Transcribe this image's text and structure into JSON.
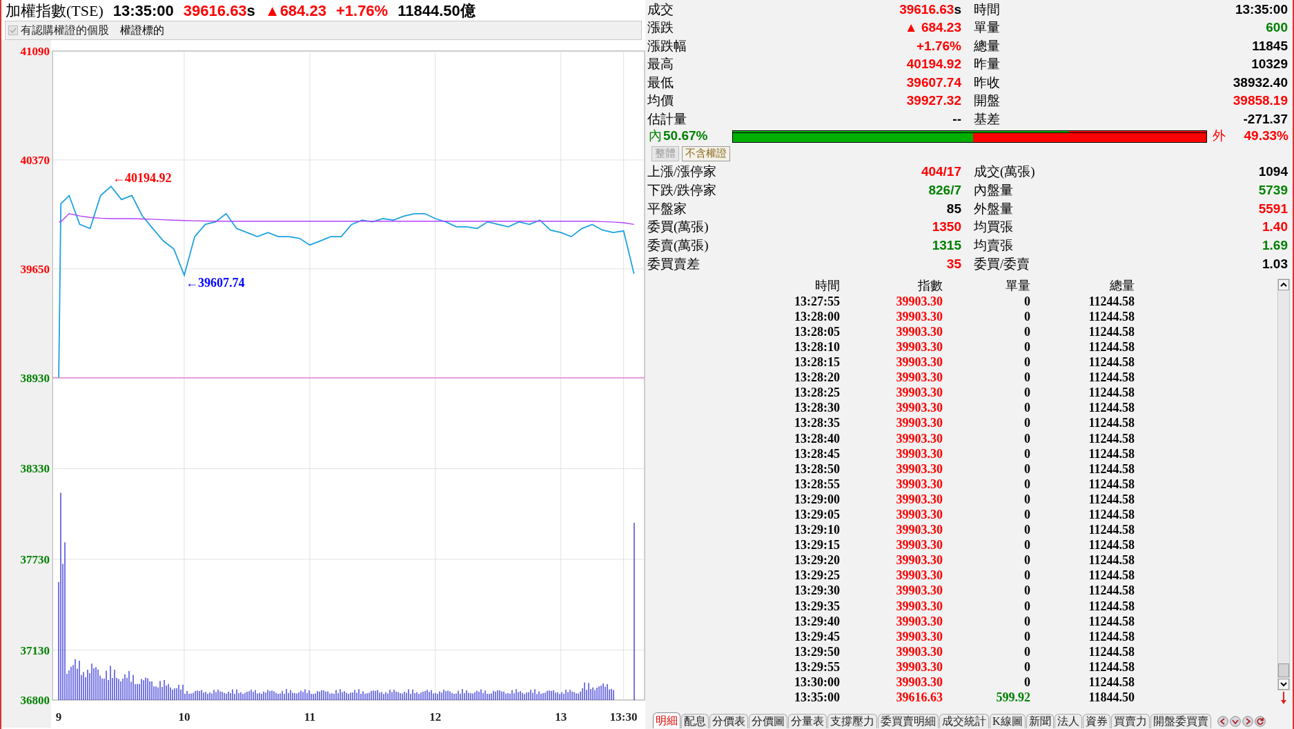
{
  "header": {
    "items": [
      {
        "kind": "name",
        "text": "加權指數(TSE)",
        "color": "#000000"
      },
      {
        "kind": "value",
        "text": "13:35:00",
        "color": "#000000"
      },
      {
        "kind": "value",
        "text": "39616.63",
        "suffix": "s",
        "color": "#ff0000"
      },
      {
        "kind": "value",
        "text": "▲684.23",
        "color": "#ff0000"
      },
      {
        "kind": "value",
        "text": "+1.76%",
        "color": "#ff0000"
      },
      {
        "kind": "value",
        "text": "11844.50億",
        "color": "#000000"
      }
    ]
  },
  "filter": {
    "checkbox": {
      "label": "有認購權證的個股",
      "checked": true,
      "disabled": true
    },
    "option": "權證標的"
  },
  "chart": {
    "chart_data": {
      "type": "line",
      "x": [
        9,
        9.017,
        9.083,
        9.167,
        9.25,
        9.333,
        9.417,
        9.5,
        9.583,
        9.667,
        9.75,
        9.833,
        9.917,
        10,
        10.083,
        10.167,
        10.25,
        10.333,
        10.417,
        10.5,
        10.583,
        10.667,
        10.75,
        10.833,
        10.917,
        11,
        11.083,
        11.167,
        11.25,
        11.333,
        11.417,
        11.5,
        11.583,
        11.667,
        11.75,
        11.833,
        11.917,
        12,
        12.083,
        12.167,
        12.25,
        12.333,
        12.417,
        12.5,
        12.583,
        12.667,
        12.75,
        12.833,
        12.917,
        13,
        13.083,
        13.167,
        13.25,
        13.333,
        13.417,
        13.5,
        13.583
      ],
      "xlim": [
        8.95,
        13.667
      ],
      "grid": true,
      "series": [
        {
          "color": "#1ba1e2",
          "values": [
            38930,
            40081,
            40135,
            39944,
            39917,
            40135,
            40195,
            40108,
            40135,
            39999,
            39917,
            39835,
            39781,
            39608,
            39863,
            39944,
            39961,
            40015,
            39917,
            39890,
            39863,
            39890,
            39863,
            39863,
            39852,
            39808,
            39835,
            39863,
            39863,
            39944,
            39972,
            39961,
            39982,
            39972,
            39999,
            40015,
            40015,
            39982,
            39961,
            39928,
            39928,
            39917,
            39961,
            39944,
            39928,
            39961,
            39944,
            39972,
            39906,
            39890,
            39863,
            39917,
            39944,
            39906,
            39890,
            39901,
            39617
          ]
        },
        {
          "color": "#b040ff",
          "values": [
            39961,
            39961,
            40015,
            40000,
            39990,
            39985,
            39982,
            39982,
            39982,
            39980,
            39978,
            39975,
            39972,
            39970,
            39968,
            39966,
            39965,
            39965,
            39965,
            39965,
            39965,
            39965,
            39965,
            39965,
            39965,
            39965,
            39965,
            39965,
            39965,
            39965,
            39965,
            39965,
            39965,
            39965,
            39965,
            39965,
            39965,
            39965,
            39965,
            39965,
            39965,
            39965,
            39965,
            39965,
            39965,
            39965,
            39965,
            39965,
            39965,
            39965,
            39965,
            39965,
            39965,
            39962,
            39960,
            39955,
            39944
          ]
        }
      ],
      "ylim": [
        36800,
        41090
      ],
      "yticks": [
        36800,
        37130,
        37730,
        38330,
        38930,
        39650,
        40370,
        41090
      ],
      "xticks": [
        {
          "value": 9,
          "label": "9"
        },
        {
          "value": 10,
          "label": "10"
        },
        {
          "value": 11,
          "label": "11"
        },
        {
          "value": 12,
          "label": "12"
        },
        {
          "value": 13,
          "label": "13"
        },
        {
          "value": 13.5,
          "label": "13:30"
        }
      ],
      "ref_lines": [
        {
          "axis": "y",
          "value": 38930
        }
      ],
      "annotations": [
        {
          "text": "←40194.92",
          "x": 9.417,
          "y": 40194.92
        },
        {
          "text": "←39607.74",
          "x": 10,
          "y": 39607.74
        }
      ]
    }
  },
  "quote_rows": [
    [
      {
        "label": "成交",
        "value": "39616.63",
        "suffix": "s",
        "color": "#ff0000"
      },
      {
        "label": "時間",
        "value": "13:35:00",
        "color": "#000000"
      }
    ],
    [
      {
        "label": "漲跌",
        "value": "▲ 684.23",
        "color": "#ff0000"
      },
      {
        "label": "單量",
        "value": "600",
        "color": "#008000"
      }
    ],
    [
      {
        "label": "漲跌幅",
        "value": "+1.76%",
        "color": "#ff0000"
      },
      {
        "label": "總量",
        "value": "11845",
        "color": "#000000"
      }
    ],
    [
      {
        "label": "最高",
        "value": "40194.92",
        "color": "#ff0000"
      },
      {
        "label": "昨量",
        "value": "10329",
        "color": "#000000"
      }
    ],
    [
      {
        "label": "最低",
        "value": "39607.74",
        "color": "#ff0000"
      },
      {
        "label": "昨收",
        "value": "38932.40",
        "color": "#000000"
      }
    ],
    [
      {
        "label": "均價",
        "value": "39927.32",
        "color": "#ff0000"
      },
      {
        "label": "開盤",
        "value": "39858.19",
        "color": "#ff0000"
      }
    ],
    [
      {
        "label": "估計量",
        "value": "--",
        "color": "#000000"
      },
      {
        "label": "基差",
        "value": "-271.37",
        "color": "#000000"
      }
    ]
  ],
  "trade_bar": {
    "inner_label": "內",
    "inner_pct": "50.67%",
    "outer_label": "外",
    "outer_pct": "49.33%",
    "strips": [
      {
        "level": 0.71
      },
      {
        "level": 0.5067
      }
    ]
  },
  "scope_buttons": [
    {
      "label": "整體",
      "selected": true
    },
    {
      "label": "不含權證",
      "selected": false
    }
  ],
  "breadth_rows": [
    [
      {
        "label": "上漲/漲停家",
        "value": "404/17",
        "color": "#ff0000"
      },
      {
        "label": "成交(萬張)",
        "value": "1094",
        "color": "#000000"
      }
    ],
    [
      {
        "label": "下跌/跌停家",
        "value": "826/7",
        "color": "#008000"
      },
      {
        "label": "內盤量",
        "value": "5739",
        "color": "#008000"
      }
    ],
    [
      {
        "label": "平盤家",
        "value": "85",
        "color": "#000000"
      },
      {
        "label": "外盤量",
        "value": "5591",
        "color": "#ff0000"
      }
    ],
    [
      {
        "label": "委買(萬張)",
        "value": "1350",
        "color": "#ff0000"
      },
      {
        "label": "均買張",
        "value": "1.40",
        "color": "#ff0000"
      }
    ],
    [
      {
        "label": "委賣(萬張)",
        "value": "1315",
        "color": "#008000"
      },
      {
        "label": "均賣張",
        "value": "1.69",
        "color": "#008000"
      }
    ],
    [
      {
        "label": "委買賣差",
        "value": "35",
        "color": "#ff0000"
      },
      {
        "label": "委買/委賣",
        "value": "1.03",
        "color": "#000000"
      }
    ]
  ],
  "ticks_table": {
    "columns": [
      "時間",
      "指數",
      "單量",
      "總量"
    ],
    "rows": [
      {
        "time": "13:27:55",
        "index": "39903.30",
        "volume": "0",
        "color": "#000000",
        "total": "11244.58"
      },
      {
        "time": "13:28:00",
        "index": "39903.30",
        "volume": "0",
        "color": "#000000",
        "total": "11244.58"
      },
      {
        "time": "13:28:05",
        "index": "39903.30",
        "volume": "0",
        "color": "#000000",
        "total": "11244.58"
      },
      {
        "time": "13:28:10",
        "index": "39903.30",
        "volume": "0",
        "color": "#000000",
        "total": "11244.58"
      },
      {
        "time": "13:28:15",
        "index": "39903.30",
        "volume": "0",
        "color": "#000000",
        "total": "11244.58"
      },
      {
        "time": "13:28:20",
        "index": "39903.30",
        "volume": "0",
        "color": "#000000",
        "total": "11244.58"
      },
      {
        "time": "13:28:25",
        "index": "39903.30",
        "volume": "0",
        "color": "#000000",
        "total": "11244.58"
      },
      {
        "time": "13:28:30",
        "index": "39903.30",
        "volume": "0",
        "color": "#000000",
        "total": "11244.58"
      },
      {
        "time": "13:28:35",
        "index": "39903.30",
        "volume": "0",
        "color": "#000000",
        "total": "11244.58"
      },
      {
        "time": "13:28:40",
        "index": "39903.30",
        "volume": "0",
        "color": "#000000",
        "total": "11244.58"
      },
      {
        "time": "13:28:45",
        "index": "39903.30",
        "volume": "0",
        "color": "#000000",
        "total": "11244.58"
      },
      {
        "time": "13:28:50",
        "index": "39903.30",
        "volume": "0",
        "color": "#000000",
        "total": "11244.58"
      },
      {
        "time": "13:28:55",
        "index": "39903.30",
        "volume": "0",
        "color": "#000000",
        "total": "11244.58"
      },
      {
        "time": "13:29:00",
        "index": "39903.30",
        "volume": "0",
        "color": "#000000",
        "total": "11244.58"
      },
      {
        "time": "13:29:05",
        "index": "39903.30",
        "volume": "0",
        "color": "#000000",
        "total": "11244.58"
      },
      {
        "time": "13:29:10",
        "index": "39903.30",
        "volume": "0",
        "color": "#000000",
        "total": "11244.58"
      },
      {
        "time": "13:29:15",
        "index": "39903.30",
        "volume": "0",
        "color": "#000000",
        "total": "11244.58"
      },
      {
        "time": "13:29:20",
        "index": "39903.30",
        "volume": "0",
        "color": "#000000",
        "total": "11244.58"
      },
      {
        "time": "13:29:25",
        "index": "39903.30",
        "volume": "0",
        "color": "#000000",
        "total": "11244.58"
      },
      {
        "time": "13:29:30",
        "index": "39903.30",
        "volume": "0",
        "color": "#000000",
        "total": "11244.58"
      },
      {
        "time": "13:29:35",
        "index": "39903.30",
        "volume": "0",
        "color": "#000000",
        "total": "11244.58"
      },
      {
        "time": "13:29:40",
        "index": "39903.30",
        "volume": "0",
        "color": "#000000",
        "total": "11244.58"
      },
      {
        "time": "13:29:45",
        "index": "39903.30",
        "volume": "0",
        "color": "#000000",
        "total": "11244.58"
      },
      {
        "time": "13:29:50",
        "index": "39903.30",
        "volume": "0",
        "color": "#000000",
        "total": "11244.58"
      },
      {
        "time": "13:29:55",
        "index": "39903.30",
        "volume": "0",
        "color": "#000000",
        "total": "11244.58"
      },
      {
        "time": "13:30:00",
        "index": "39903.30",
        "volume": "0",
        "color": "#000000",
        "total": "11244.58"
      },
      {
        "time": "13:35:00",
        "index": "39616.63",
        "volume": "599.92",
        "color": "#008000",
        "total": "11844.50"
      }
    ]
  },
  "tabs": [
    {
      "label": "明細",
      "selected": true
    },
    {
      "label": "配息",
      "selected": false
    },
    {
      "label": "分價表",
      "selected": false
    },
    {
      "label": "分價圖",
      "selected": false
    },
    {
      "label": "分量表",
      "selected": false
    },
    {
      "label": "支撐壓力",
      "selected": false
    },
    {
      "label": "委買賣明細",
      "selected": false
    },
    {
      "label": "成交統計",
      "selected": false
    },
    {
      "label": "K線圖",
      "selected": false
    },
    {
      "label": "新聞",
      "selected": false
    },
    {
      "label": "法人",
      "selected": false
    },
    {
      "label": "資券",
      "selected": false
    },
    {
      "label": "買賣力",
      "selected": false
    },
    {
      "label": "開盤委買賣",
      "selected": false
    }
  ]
}
